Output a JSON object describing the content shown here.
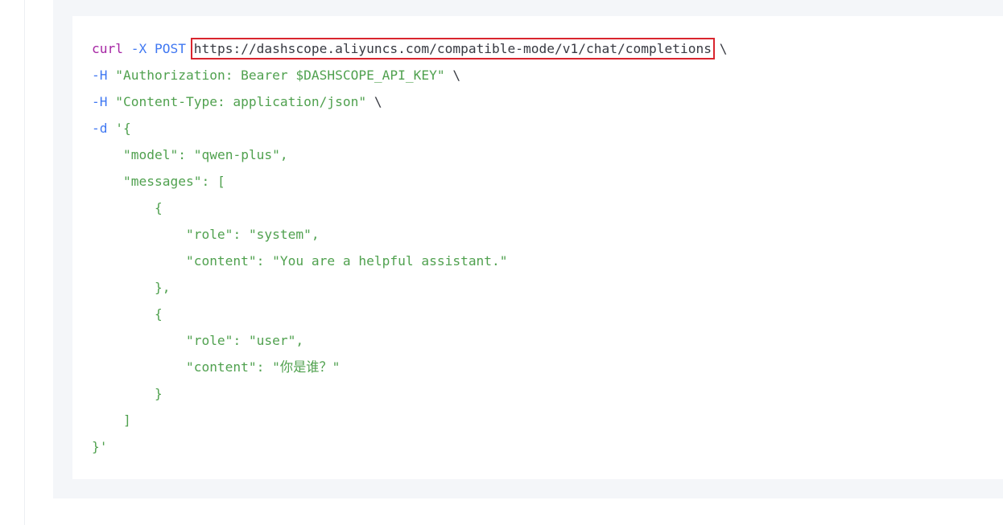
{
  "code": {
    "line1": {
      "cmd": "curl",
      "flag_x": "-X",
      "method": "POST",
      "url": "https://dashscope.aliyuncs.com/compatible-mode/v1/chat/completions",
      "cont": "\\"
    },
    "line2": {
      "flag": "-H",
      "header": "\"Authorization: Bearer $DASHSCOPE_API_KEY\"",
      "cont": "\\"
    },
    "line3": {
      "flag": "-H",
      "header": "\"Content-Type: application/json\"",
      "cont": "\\"
    },
    "line4": {
      "flag": "-d",
      "open": "'{"
    },
    "line5": {
      "indent": "    ",
      "key": "\"model\"",
      "sep": ": ",
      "val": "\"qwen-plus\"",
      "end": ","
    },
    "line6": {
      "indent": "    ",
      "key": "\"messages\"",
      "sep": ": ",
      "open": "["
    },
    "line7": {
      "indent": "        ",
      "text": "{"
    },
    "line8": {
      "indent": "            ",
      "key": "\"role\"",
      "sep": ": ",
      "val": "\"system\"",
      "end": ","
    },
    "line9": {
      "indent": "            ",
      "key": "\"content\"",
      "sep": ": ",
      "val": "\"You are a helpful assistant.\"",
      "end": ""
    },
    "line10": {
      "indent": "        ",
      "text": "},"
    },
    "line11": {
      "indent": "        ",
      "text": "{"
    },
    "line12": {
      "indent": "            ",
      "key": "\"role\"",
      "sep": ": ",
      "val": "\"user\"",
      "end": ","
    },
    "line13": {
      "indent": "            ",
      "key": "\"content\"",
      "sep": ": ",
      "val": "\"你是谁？\"",
      "end": ""
    },
    "line14": {
      "indent": "        ",
      "text": "}"
    },
    "line15": {
      "indent": "    ",
      "text": "]"
    },
    "line16": {
      "text": "}'"
    }
  },
  "colors": {
    "highlight_border": "#d9252e",
    "panel_background": "#f4f6f9",
    "string": "#50a14f",
    "keyword": "#a626a4",
    "flag": "#4078f2"
  }
}
